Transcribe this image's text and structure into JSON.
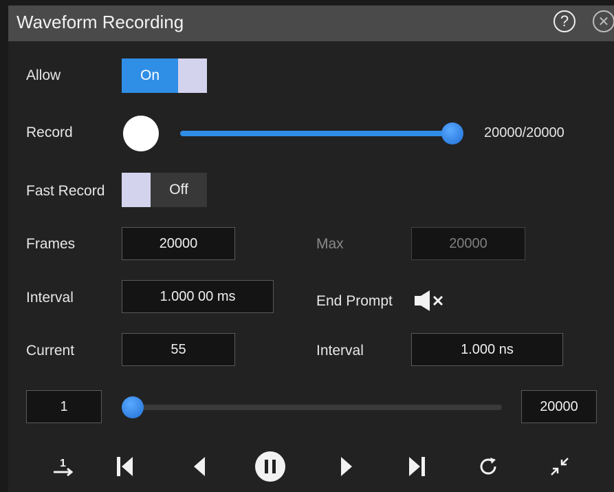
{
  "window": {
    "title": "Waveform Recording"
  },
  "header": {
    "help_glyph": "?",
    "close_glyph": "✕"
  },
  "allow": {
    "label": "Allow",
    "state": "On"
  },
  "record": {
    "label": "Record",
    "progress_text": "20000/20000",
    "progress_fraction": 1.0
  },
  "fast_record": {
    "label": "Fast Record",
    "state": "Off"
  },
  "frames": {
    "label": "Frames",
    "value": "20000",
    "max_label": "Max",
    "max_value": "20000"
  },
  "interval": {
    "label": "Interval",
    "value": "1.000 00 ms"
  },
  "end_prompt": {
    "label": "End Prompt",
    "icon": "speaker-muted-icon"
  },
  "current": {
    "label": "Current",
    "value": "55",
    "interval_label": "Interval",
    "interval_value": "1.000 ns"
  },
  "frame_range": {
    "start": "1",
    "end": "20000",
    "position_fraction": 0.0
  },
  "playback": {
    "goto_first_glyph": "1",
    "icons": [
      "goto-frame-icon",
      "skip-to-start-icon",
      "step-back-icon",
      "pause-icon",
      "step-forward-icon",
      "skip-to-end-icon",
      "replay-icon",
      "collapse-icon"
    ]
  },
  "colors": {
    "accent": "#2f8ee6",
    "knob": "#d3d3ee",
    "background": "#222222",
    "titlebar": "#4a4a4a"
  }
}
